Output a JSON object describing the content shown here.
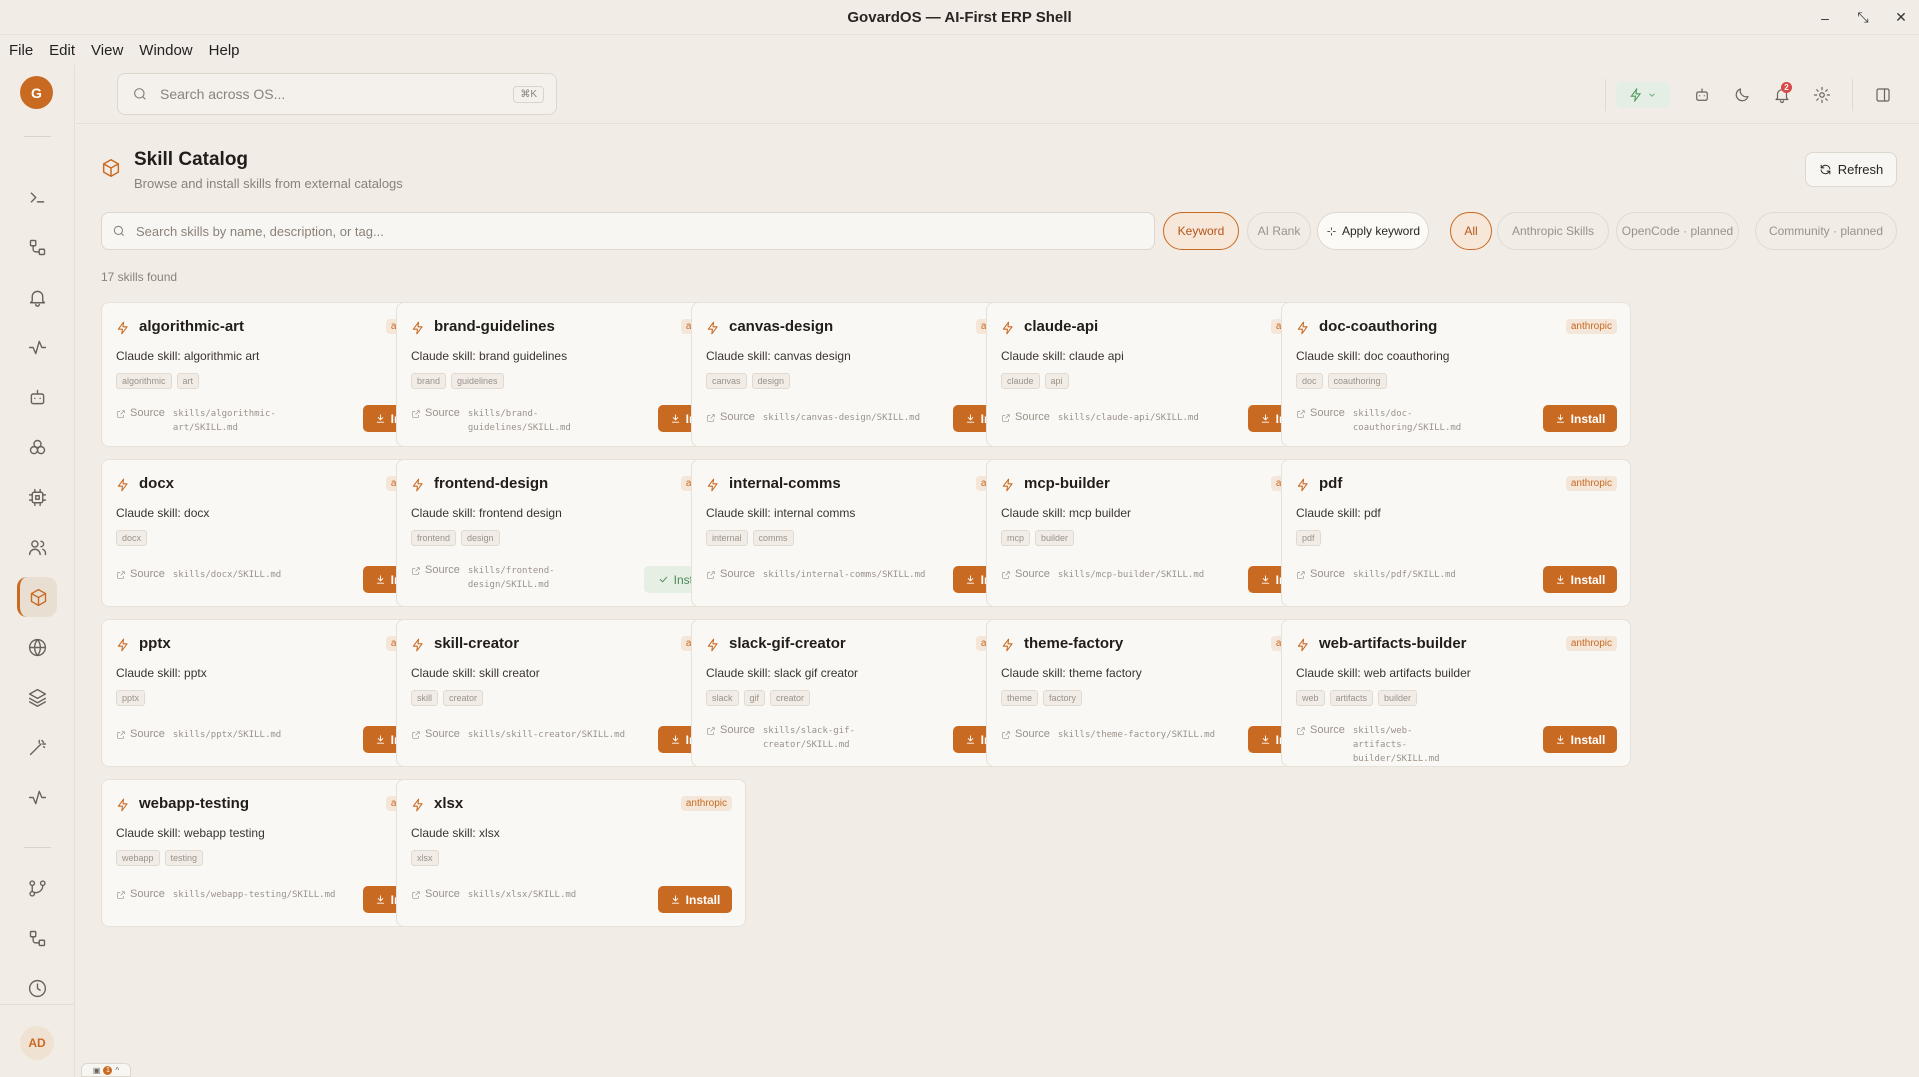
{
  "window": {
    "title": "GovardOS — AI-First ERP Shell",
    "controls": [
      "–",
      "⤡",
      "✕"
    ]
  },
  "menu": [
    "File",
    "Edit",
    "View",
    "Window",
    "Help"
  ],
  "sidebar": {
    "logo": "G",
    "user": "AD"
  },
  "topbar": {
    "search_placeholder": "Search across OS...",
    "shortcut": "⌘K",
    "notifications_count": "2"
  },
  "header": {
    "title": "Skill Catalog",
    "subtitle": "Browse and install skills from external catalogs",
    "refresh_label": "Refresh"
  },
  "filters": {
    "search_placeholder": "Search skills by name, description, or tag...",
    "mode_keyword": "Keyword",
    "mode_ai": "AI Rank",
    "apply": "Apply keyword",
    "sources": [
      "All",
      "Anthropic Skills",
      "OpenCode · planned",
      "Community · planned"
    ]
  },
  "results_count": "17 skills found",
  "source_label": "Source",
  "install_label": "Install",
  "installed_label": "Installed",
  "skills": [
    {
      "name": "algorithmic-art",
      "provider": "anthropic",
      "desc": "Claude skill: algorithmic art",
      "tags": [
        "algorithmic",
        "art"
      ],
      "path": "skills/algorithmic-art/SKILL.md",
      "installed": false
    },
    {
      "name": "brand-guidelines",
      "provider": "anthropic",
      "desc": "Claude skill: brand guidelines",
      "tags": [
        "brand",
        "guidelines"
      ],
      "path": "skills/brand-guidelines/SKILL.md",
      "installed": false
    },
    {
      "name": "canvas-design",
      "provider": "anthropic",
      "desc": "Claude skill: canvas design",
      "tags": [
        "canvas",
        "design"
      ],
      "path": "skills/canvas-design/SKILL.md",
      "installed": false
    },
    {
      "name": "claude-api",
      "provider": "anthropic",
      "desc": "Claude skill: claude api",
      "tags": [
        "claude",
        "api"
      ],
      "path": "skills/claude-api/SKILL.md",
      "installed": false
    },
    {
      "name": "doc-coauthoring",
      "provider": "anthropic",
      "desc": "Claude skill: doc coauthoring",
      "tags": [
        "doc",
        "coauthoring"
      ],
      "path": "skills/doc-coauthoring/SKILL.md",
      "installed": false
    },
    {
      "name": "docx",
      "provider": "anthropic",
      "desc": "Claude skill: docx",
      "tags": [
        "docx"
      ],
      "path": "skills/docx/SKILL.md",
      "installed": false
    },
    {
      "name": "frontend-design",
      "provider": "anthropic",
      "desc": "Claude skill: frontend design",
      "tags": [
        "frontend",
        "design"
      ],
      "path": "skills/frontend-design/SKILL.md",
      "installed": true
    },
    {
      "name": "internal-comms",
      "provider": "anthropic",
      "desc": "Claude skill: internal comms",
      "tags": [
        "internal",
        "comms"
      ],
      "path": "skills/internal-comms/SKILL.md",
      "installed": false
    },
    {
      "name": "mcp-builder",
      "provider": "anthropic",
      "desc": "Claude skill: mcp builder",
      "tags": [
        "mcp",
        "builder"
      ],
      "path": "skills/mcp-builder/SKILL.md",
      "installed": false
    },
    {
      "name": "pdf",
      "provider": "anthropic",
      "desc": "Claude skill: pdf",
      "tags": [
        "pdf"
      ],
      "path": "skills/pdf/SKILL.md",
      "installed": false
    },
    {
      "name": "pptx",
      "provider": "anthropic",
      "desc": "Claude skill: pptx",
      "tags": [
        "pptx"
      ],
      "path": "skills/pptx/SKILL.md",
      "installed": false
    },
    {
      "name": "skill-creator",
      "provider": "anthropic",
      "desc": "Claude skill: skill creator",
      "tags": [
        "skill",
        "creator"
      ],
      "path": "skills/skill-creator/SKILL.md",
      "installed": false
    },
    {
      "name": "slack-gif-creator",
      "provider": "anthropic",
      "desc": "Claude skill: slack gif creator",
      "tags": [
        "slack",
        "gif",
        "creator"
      ],
      "path": "skills/slack-gif-creator/SKILL.md",
      "installed": false
    },
    {
      "name": "theme-factory",
      "provider": "anthropic",
      "desc": "Claude skill: theme factory",
      "tags": [
        "theme",
        "factory"
      ],
      "path": "skills/theme-factory/SKILL.md",
      "installed": false
    },
    {
      "name": "web-artifacts-builder",
      "provider": "anthropic",
      "desc": "Claude skill: web artifacts builder",
      "tags": [
        "web",
        "artifacts",
        "builder"
      ],
      "path": "skills/web-artifacts-builder/SKILL.md",
      "installed": false
    },
    {
      "name": "webapp-testing",
      "provider": "anthropic",
      "desc": "Claude skill: webapp testing",
      "tags": [
        "webapp",
        "testing"
      ],
      "path": "skills/webapp-testing/SKILL.md",
      "installed": false
    },
    {
      "name": "xlsx",
      "provider": "anthropic",
      "desc": "Claude skill: xlsx",
      "tags": [
        "xlsx"
      ],
      "path": "skills/xlsx/SKILL.md",
      "installed": false
    }
  ],
  "status": {
    "count": "1"
  },
  "colors": {
    "accent": "#c96a22",
    "success": "#4a8a55",
    "background": "#f1ede6"
  }
}
